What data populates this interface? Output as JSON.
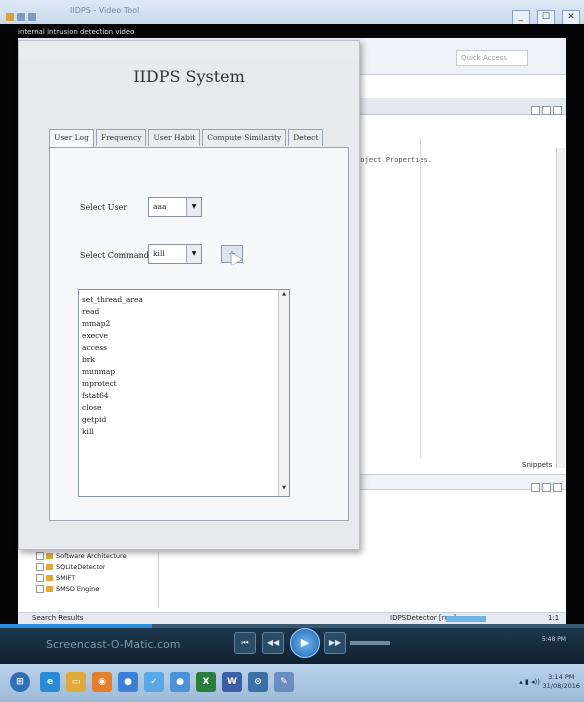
{
  "outer_window": {
    "title": "IIDPS - Video Tool",
    "video_title": "internal intrusion detection video",
    "buttons": [
      "_",
      "☐",
      "✕"
    ]
  },
  "ide": {
    "search_placeholder": "Quick Access",
    "editor_text": "Project Properties.",
    "panel_tab": "Snippets",
    "tree": [
      {
        "label": "Software Architecture"
      },
      {
        "label": "SQLiteDetector"
      },
      {
        "label": "SMIFT"
      },
      {
        "label": "SMSD Engine"
      }
    ],
    "search_results_label": "Search Results",
    "status_text": "IDPSDetector [run]",
    "zoom_text": "1:1"
  },
  "app": {
    "heading": "IIDPS System",
    "tabs": [
      {
        "label": "User Log",
        "active": true
      },
      {
        "label": "Frequency",
        "active": false
      },
      {
        "label": "User Habit",
        "active": false
      },
      {
        "label": "Compute Similarity",
        "active": false
      },
      {
        "label": "Detect",
        "active": false
      }
    ],
    "user_label": "Select User",
    "user_value": "aaa",
    "command_label": "Select Command",
    "command_value": "kill",
    "add_button": "+",
    "commands": [
      "set_thread_area",
      "read",
      "mmap2",
      "execve",
      "access",
      "brk",
      "munmap",
      "mprotect",
      "fstat64",
      "close",
      "getpid",
      "kill"
    ]
  },
  "player": {
    "watermark": "Screencast-O-Matic.com",
    "time": "5:48 PM",
    "controls": [
      "⏮",
      "◀◀",
      "▶",
      "▶▶",
      "⏭"
    ]
  },
  "taskbar": {
    "time": "3:14 PM",
    "date": "31/08/2016"
  }
}
